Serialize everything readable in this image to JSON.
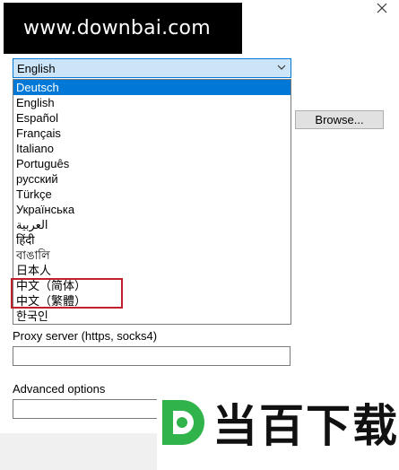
{
  "watermark": {
    "top_text": "www.downbai.com",
    "bottom_text": "当百下载"
  },
  "language_select": {
    "value": "English",
    "options": [
      "Deutsch",
      "English",
      "Español",
      "Français",
      "Italiano",
      "Português",
      "русский",
      "Türkçe",
      "Українська",
      "العربية",
      "हिंदी",
      "বাঙালি",
      "日本人",
      "中文（简体）",
      "中文（繁體）",
      "한국인"
    ],
    "highlighted_index": 0,
    "annotated_indices": [
      13,
      14
    ]
  },
  "browse_button": {
    "label": "Browse..."
  },
  "proxy": {
    "label": "Proxy server (https, socks4)",
    "value": ""
  },
  "advanced": {
    "label": "Advanced options",
    "value": ""
  },
  "colors": {
    "selection": "#0078d7",
    "select_bg": "#cce4f7",
    "annotation": "#c0202c",
    "logo_green": "#2fb34a"
  }
}
